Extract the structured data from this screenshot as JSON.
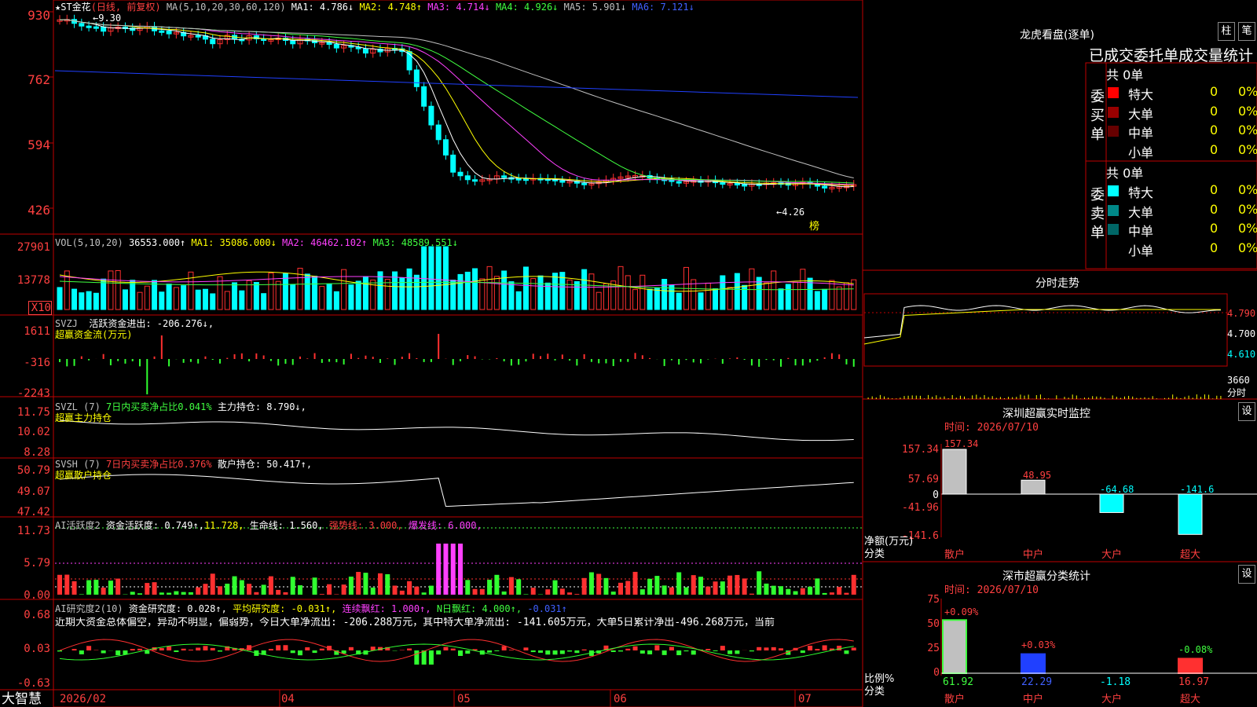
{
  "main_header": {
    "title": "★ST金花",
    "mode": "(日线, 前复权)",
    "ma": "MA(5,10,20,30,60,120)",
    "ma1": "MA1: 4.786↓",
    "ma2": "MA2: 4.748↑",
    "ma3": "MA3: 4.714↓",
    "ma4": "MA4: 4.926↓",
    "ma5": "MA5: 5.901↓",
    "ma6": "MA6: 7.121↓"
  },
  "main_axis": [
    "930",
    "762",
    "594",
    "426"
  ],
  "price_marks": {
    "high": "9.30",
    "low": "4.26",
    "bang": "榜"
  },
  "vol_header": {
    "label": "VOL(5,10,20)",
    "v": "36553.000↑",
    "ma1": "MA1: 35086.000↓",
    "ma2": "MA2: 46462.102↑",
    "ma3": "MA3: 48589.551↓"
  },
  "vol_axis": [
    "27901",
    "13778",
    "X10"
  ],
  "svzj_header": {
    "label": "SVZJ",
    "t": "活跃资金进出: -206.276↓,",
    "sub": "超赢资金流(万元)"
  },
  "svzj_axis": [
    "1611",
    "-316",
    "-2243"
  ],
  "svzl_header": {
    "label": "SVZL (7)",
    "t1": "7日内买卖净占比0.041%",
    "t2": "主力持仓: 8.790↓,",
    "sub": "超赢主力持仓"
  },
  "svzl_axis": [
    "11.75",
    "10.02",
    "8.28"
  ],
  "svsh_header": {
    "label": "SVSH (7)",
    "t1": "7日内买卖净占比0.376%",
    "t2": "散户持仓: 50.417↑,",
    "sub": "超赢散户持仓"
  },
  "svsh_axis": [
    "50.79",
    "49.07",
    "47.42"
  ],
  "ai1_header": {
    "label": "AI活跃度2",
    "t1": "资金活跃度: 0.749↑,",
    "t2": "11.728,",
    "t3": "生命线: 1.560,",
    "t4": "强势线: 3.000,",
    "t5": "爆发线: 6.000,"
  },
  "ai1_axis": [
    "11.73",
    "5.79",
    "0.00"
  ],
  "ai2_header": {
    "label": "AI研究度2(10)",
    "t1": "资金研究度: 0.028↑,",
    "t2": "平均研究度: -0.031↑,",
    "t3": "连续飘红: 1.000↑,",
    "t4": "N日飘红: 4.000↑,",
    "t5": "-0.031↑"
  },
  "ai2_text": "近期大资金总体偏空，异动不明显，偏弱势，今日大单净流出: -206.288万元，其中特大单净流出: -141.605万元，大单5日累计净出-496.268万元，当前",
  "ai2_axis": [
    "0.68",
    "0.03",
    "-0.63"
  ],
  "bottom": {
    "brand": "大智慧",
    "dates": [
      "2026/02",
      "04",
      "05",
      "06",
      "07"
    ]
  },
  "right": {
    "lhb_title": "龙虎看盘(逐单)",
    "btn_zhu": "柱",
    "btn_bi": "笔",
    "stat_title": "已成交委托单成交量统计",
    "buy_label": "委买单",
    "sell_label": "委卖单",
    "buy_total": "共 0单",
    "sell_total": "共 0单",
    "buy_rows": [
      {
        "k": "特大",
        "v": "0",
        "p": "0%"
      },
      {
        "k": "大单",
        "v": "0",
        "p": "0%"
      },
      {
        "k": "中单",
        "v": "0",
        "p": "0%"
      },
      {
        "k": "小单",
        "v": "0",
        "p": "0%"
      }
    ],
    "sell_rows": [
      {
        "k": "特大",
        "v": "0",
        "p": "0%"
      },
      {
        "k": "大单",
        "v": "0",
        "p": "0%"
      },
      {
        "k": "中单",
        "v": "0",
        "p": "0%"
      },
      {
        "k": "小单",
        "v": "0",
        "p": "0%"
      }
    ],
    "buy_colors": [
      "#ff0000",
      "#990000",
      "#660000",
      "#000000"
    ],
    "sell_colors": [
      "#00ffff",
      "#008888",
      "#006666",
      "#000000"
    ],
    "fenshi_title": "分时走势",
    "fenshi_axis": [
      "4.790",
      "4.700",
      "4.610"
    ],
    "fenshi_vol": [
      "3660",
      "分时"
    ],
    "sz_title": "深圳超赢实时监控",
    "sz_btn": "设",
    "sz_time": "时间: 2026/07/10",
    "sz_axis": [
      "157.34",
      "57.69",
      "0",
      "-41.96",
      "-141.6"
    ],
    "sz_unit": "净额(万元)",
    "sz_fenlei": "分类",
    "sz_cats": [
      "散户",
      "中户",
      "大户",
      "超大"
    ],
    "sz_vals": [
      "157.34",
      "48.95",
      "-64.68",
      "-141.6"
    ],
    "sz_values": [
      157.34,
      48.95,
      -64.68,
      -141.6
    ],
    "fl_title": "深市超赢分类统计",
    "fl_btn": "设",
    "fl_time": "时间: 2026/07/10",
    "fl_axis": [
      "75",
      "50",
      "25",
      "0"
    ],
    "fl_unit": "比例%",
    "fl_fenlei": "分类",
    "fl_pcts": [
      "+0.09%",
      "+0.03%",
      "-0.08%"
    ],
    "fl_vals": [
      "61.92",
      "22.29",
      "-1.18",
      "16.97"
    ],
    "fl_values": [
      61.92,
      22.29,
      -1.18,
      16.97
    ],
    "fl_cats": [
      "散户",
      "中户",
      "大户",
      "超大"
    ]
  }
}
